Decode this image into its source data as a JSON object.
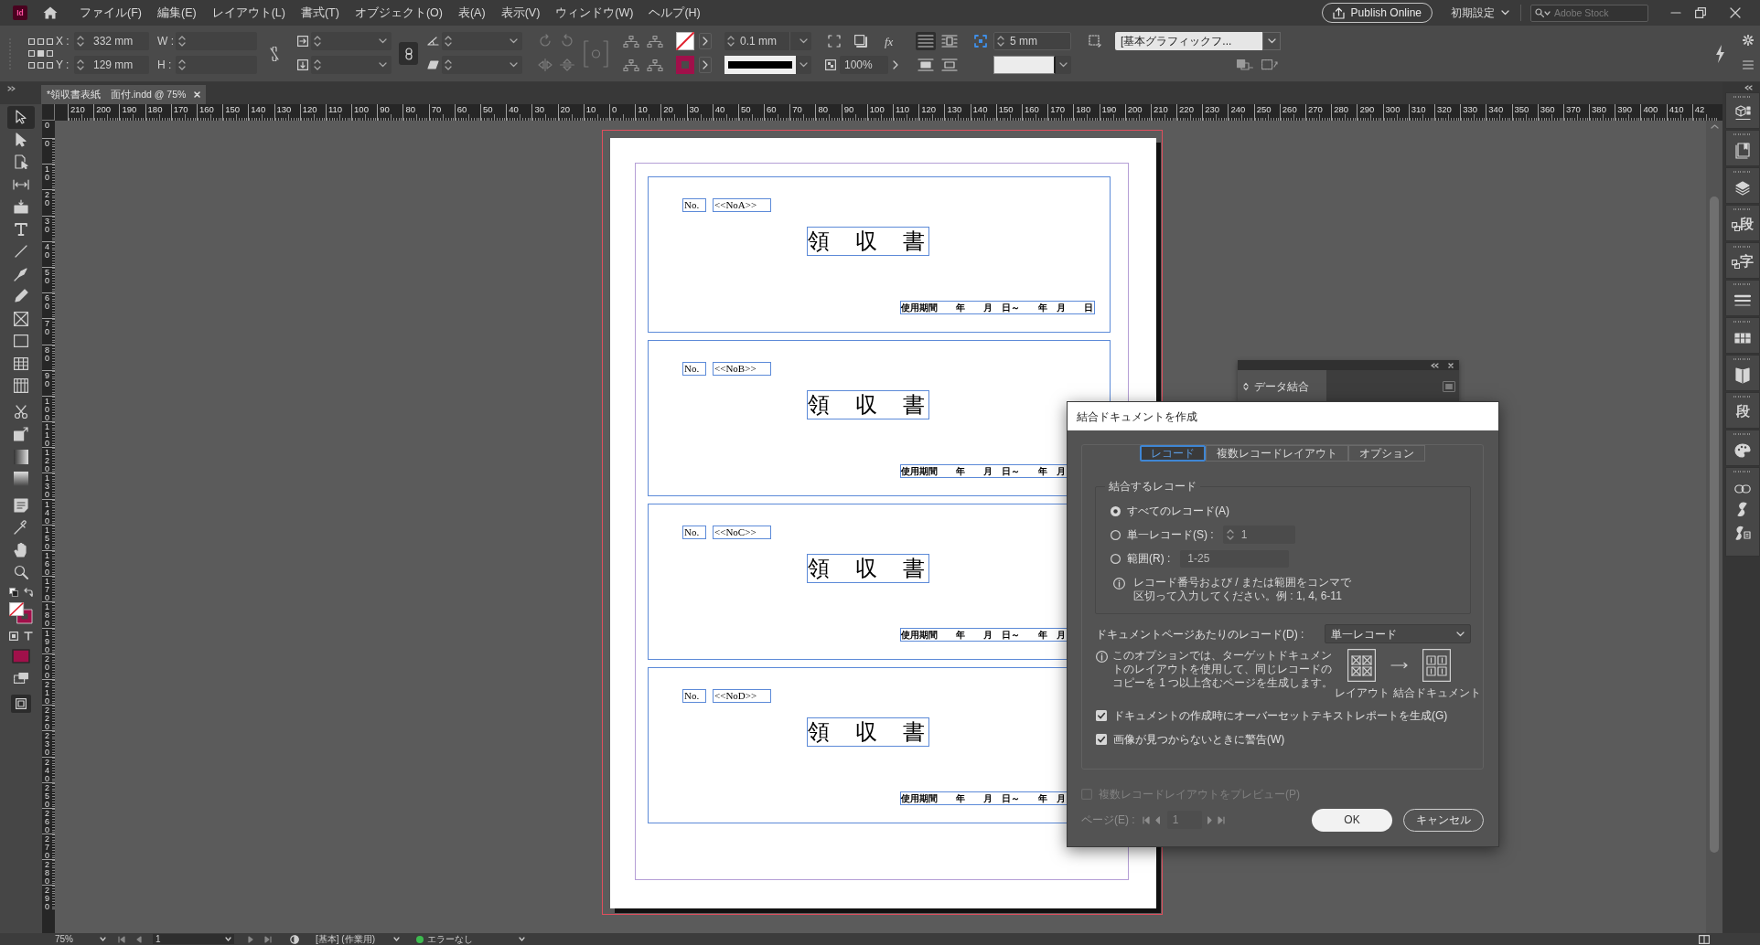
{
  "app": {
    "logo": "Id"
  },
  "menu_bar": {
    "items": [
      "ファイル(F)",
      "編集(E)",
      "レイアウト(L)",
      "書式(T)",
      "オブジェクト(O)",
      "表(A)",
      "表示(V)",
      "ウィンドウ(W)",
      "ヘルプ(H)"
    ],
    "publish_button": "Publish Online",
    "workspace": "初期設定",
    "search": {
      "placeholder": "Adobe Stock"
    }
  },
  "control_panel": {
    "x": {
      "label": "X :",
      "value": "332 mm"
    },
    "y": {
      "label": "Y :",
      "value": "129 mm"
    },
    "w": {
      "label": "W :"
    },
    "h": {
      "label": "H :"
    },
    "constrain_proportions": true,
    "stroke_weight": "0.1 mm",
    "effects_label": "fx",
    "opacity": "100%",
    "wrap_modes": [
      {
        "selected": true
      },
      {
        "selected": false
      },
      {
        "selected": false
      },
      {
        "selected": false
      }
    ],
    "fitting_offset": "5 mm",
    "object_style": "[基本グラフィックフ..."
  },
  "document_tab": {
    "title": "*領収書表紙　面付.indd @ 75%"
  },
  "tools": [
    {
      "selected": true
    },
    {
      "selected": false
    },
    {
      "selected": false
    },
    {
      "selected": false
    },
    {
      "selected": false
    },
    {
      "selected": false
    },
    {
      "selected": false
    },
    {
      "selected": false
    },
    {
      "selected": false
    },
    {
      "selected": false
    },
    {
      "selected": false
    },
    {
      "selected": false
    },
    {
      "selected": false
    },
    {
      "selected": false
    },
    {
      "selected": false
    },
    {
      "selected": false
    },
    {
      "selected": false
    },
    {
      "selected": false
    },
    {
      "selected": false
    },
    {
      "selected": false
    },
    {
      "selected": false
    }
  ],
  "rulers": {
    "horizontal": [
      "210",
      "200",
      "190",
      "180",
      "170",
      "160",
      "150",
      "140",
      "130",
      "120",
      "110",
      "100",
      "90",
      "80",
      "70",
      "60",
      "50",
      "40",
      "30",
      "20",
      "10",
      "0",
      "10",
      "20",
      "30",
      "40",
      "50",
      "60",
      "70",
      "80",
      "90",
      "100",
      "110",
      "120",
      "130",
      "140",
      "150",
      "160",
      "170",
      "180",
      "190",
      "200",
      "210",
      "220",
      "230",
      "240",
      "250",
      "260",
      "270",
      "280",
      "290",
      "300",
      "310",
      "320",
      "330",
      "340",
      "350",
      "360",
      "370",
      "380",
      "390",
      "400",
      "410",
      "42"
    ],
    "vertical": [
      "0",
      "0",
      "10",
      "20",
      "30",
      "40",
      "50",
      "60",
      "70",
      "80",
      "90",
      "100",
      "110",
      "120",
      "130",
      "140",
      "150",
      "160",
      "170",
      "180",
      "190",
      "200",
      "210",
      "220",
      "230",
      "240",
      "250",
      "260",
      "270",
      "280",
      "290"
    ]
  },
  "page": {
    "receipts": [
      {
        "number_label": "No.",
        "number_field": "<<NoA>>",
        "title": "領　収　書",
        "period": "使用期間　　年　　月　日～　　年　月　　日"
      },
      {
        "number_label": "No.",
        "number_field": "<<NoB>>",
        "title": "領　収　書",
        "period": "使用期間　　年　　月　日～　　年　月"
      },
      {
        "number_label": "No.",
        "number_field": "<<NoC>>",
        "title": "領　収　書",
        "period": "使用期間　　年　　月　日～　　年　月"
      },
      {
        "number_label": "No.",
        "number_field": "<<NoD>>",
        "title": "領　収　書",
        "period": "使用期間　　年　　月　日～　　年　月"
      }
    ]
  },
  "right_panel": {
    "glyphs": [
      "段",
      "字",
      "段"
    ]
  },
  "data_merge_panel": {
    "title": "データ結合"
  },
  "merge_dialog": {
    "title": "結合ドキュメントを作成",
    "tabs": [
      {
        "label": "レコード",
        "selected": true
      },
      {
        "label": "複数レコードレイアウト",
        "selected": false
      },
      {
        "label": "オプション",
        "selected": false
      }
    ],
    "records_group": {
      "legend": "結合するレコード",
      "options": [
        {
          "kind": "plain",
          "label": "すべてのレコード(A)",
          "selected": true
        },
        {
          "kind": "spinner",
          "label": "単一レコード(S) :",
          "value": "1",
          "selected": false
        },
        {
          "kind": "text",
          "label": "範囲(R) :",
          "value": "1-25",
          "selected": false
        }
      ],
      "note_lines": [
        "レコード番号および / または範囲をコンマで",
        "区切って入力してください。例 : 1, 4, 6-11"
      ]
    },
    "records_per_page": {
      "label": "ドキュメントページあたりのレコード(D) :",
      "value": "単一レコード"
    },
    "per_page_note_lines": [
      "このオプションでは、ターゲットドキュメン",
      "トのレイアウトを使用して、同じレコードの",
      "コピーを 1 つ以上含むページを生成します。"
    ],
    "diagram_labels": [
      "レイアウト",
      "結合ドキュメント"
    ],
    "checkboxes": [
      {
        "label": "ドキュメントの作成時にオーバーセットテキストレポートを生成(G)",
        "checked": true
      },
      {
        "label": "画像が見つからないときに警告(W)",
        "checked": true
      }
    ],
    "preview": {
      "label": "複数レコードレイアウトをプレビュー(P)",
      "checked": false,
      "disabled": true
    },
    "page_nav": {
      "label": "ページ(E) :",
      "value": "1",
      "disabled": true
    },
    "buttons": [
      {
        "kind": "primary",
        "label": "OK"
      },
      {
        "kind": "secondary",
        "label": "キャンセル"
      }
    ]
  },
  "status_bar": {
    "zoom": "75%",
    "page": "1",
    "profile": "[基本] (作業用)",
    "preflight": "エラーなし"
  }
}
